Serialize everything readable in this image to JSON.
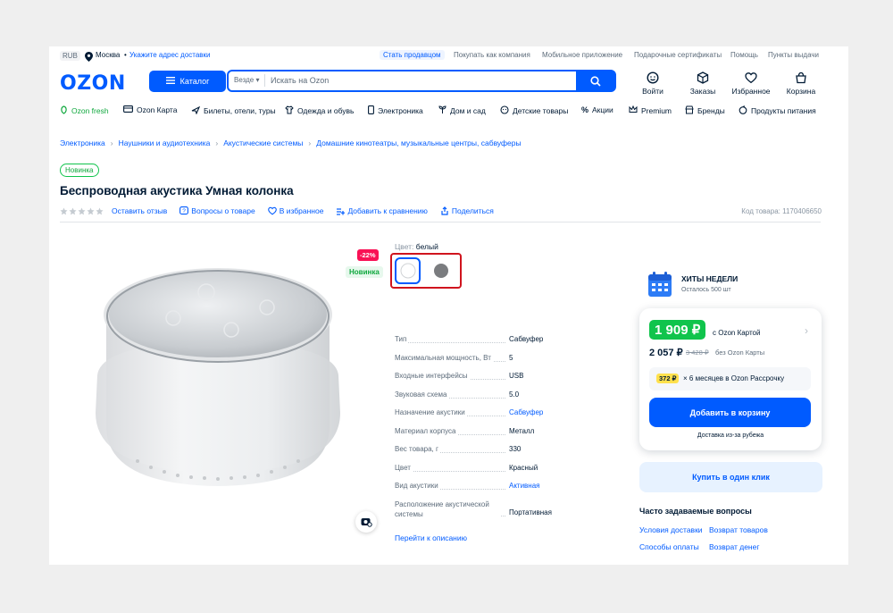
{
  "topbar": {
    "currency": "RUB",
    "city": "Москва",
    "dot": "•",
    "address_link": "Укажите адрес доставки",
    "links": [
      "Стать продавцом",
      "Покупать как компания",
      "Мобильное приложение",
      "Подарочные сертификаты",
      "Помощь",
      "Пункты выдачи"
    ]
  },
  "header": {
    "logo": "OZON",
    "catalog": "Каталог",
    "search_scope": "Везде",
    "search_placeholder": "Искать на Ozon",
    "icons": [
      {
        "label": "Войти",
        "icon": "user-icon"
      },
      {
        "label": "Заказы",
        "icon": "box-icon"
      },
      {
        "label": "Избранное",
        "icon": "heart-icon"
      },
      {
        "label": "Корзина",
        "icon": "cart-icon"
      }
    ]
  },
  "nav": [
    "Ozon fresh",
    "Ozon Карта",
    "Билеты, отели, туры",
    "Одежда и обувь",
    "Электроника",
    "Дом и сад",
    "Детские товары",
    "Акции",
    "Premium",
    "Бренды",
    "Продукты питания"
  ],
  "breadcrumbs": [
    "Электроника",
    "Наушники и аудиотехника",
    "Акустические системы",
    "Домашние кинотеатры, музыкальные центры, сабвуферы"
  ],
  "product": {
    "badge": "Новинка",
    "title": "Беспроводная акустика Умная колонка",
    "actions": [
      "Оставить отзыв",
      "Вопросы о товаре",
      "В избранное",
      "Добавить к сравнению",
      "Поделиться"
    ],
    "sku": "Код товара: 1170406650",
    "discount": "-22%",
    "novelty": "Новинка",
    "color_label": "Цвет:",
    "color_value": "белый",
    "colors": {
      "accent": "#005bff",
      "green": "#10c44c",
      "red": "#f91155",
      "selected_outline": "#d0141e"
    }
  },
  "specs": [
    {
      "k": "Тип",
      "v": "Сабвуфер",
      "link": false
    },
    {
      "k": "Максимальная мощность, Вт",
      "v": "5",
      "link": false
    },
    {
      "k": "Входные интерфейсы",
      "v": "USB",
      "link": false
    },
    {
      "k": "Звуковая схема",
      "v": "5.0",
      "link": false
    },
    {
      "k": "Назначение акустики",
      "v": "Сабвуфер",
      "link": true
    },
    {
      "k": "Материал корпуса",
      "v": "Металл",
      "link": false
    },
    {
      "k": "Вес товара, г",
      "v": "330",
      "link": false
    },
    {
      "k": "Цвет",
      "v": "Красный",
      "link": false
    },
    {
      "k": "Вид акустики",
      "v": "Активная",
      "link": true
    },
    {
      "k": "Расположение акустической системы",
      "v": "Портативная",
      "link": false
    }
  ],
  "description_link": "Перейти к описанию",
  "hits": {
    "title": "ХИТЫ НЕДЕЛИ",
    "sub": "Осталось 500 шт"
  },
  "price": {
    "card_price": "1 909 ₽",
    "card_label": "с Ozon Картой",
    "regular_price": "2 057 ₽",
    "old_price": "3 428 ₽",
    "no_card_label": "без Ozon Карты",
    "installment_amount": "372 ₽",
    "installment_text": "× 6 месяцев в Ozon Рассрочку",
    "add_to_cart": "Добавить в корзину",
    "delivery": "Доставка из-за рубежа",
    "one_click": "Купить в один клик"
  },
  "faq": {
    "title": "Часто задаваемые вопросы",
    "links": [
      "Условия доставки",
      "Возврат товаров",
      "Способы оплаты",
      "Возврат денег"
    ]
  }
}
